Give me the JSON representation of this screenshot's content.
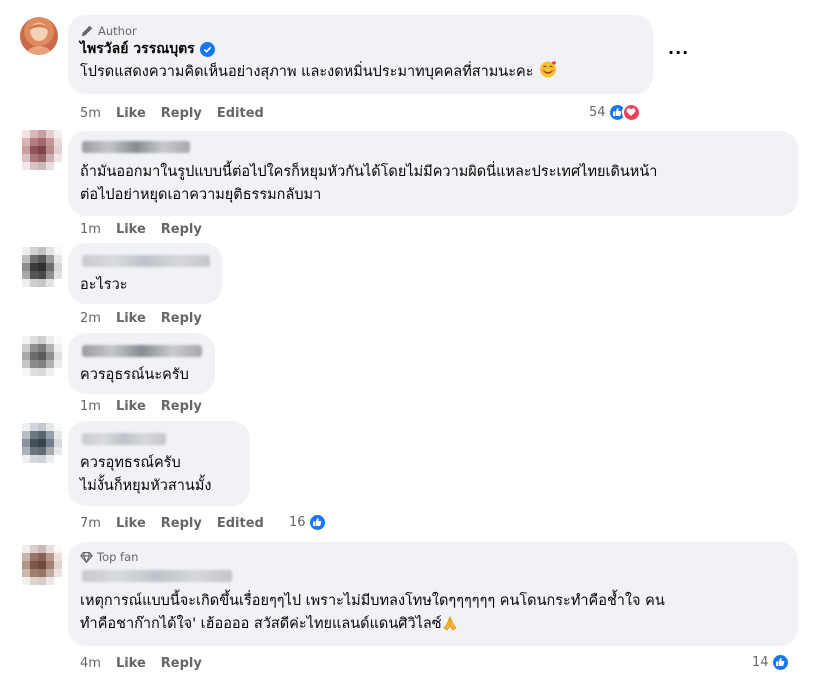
{
  "actions": {
    "like": "Like",
    "reply": "Reply",
    "edited": "Edited"
  },
  "more_label": "···",
  "comments": [
    {
      "badge": "Author",
      "name": "ไพรวัลย์ วรรณบุตร",
      "lines": [
        "โปรดแสดงความคิดเห็นอย่างสุภาพ และงดหมิ่นประมาทบุคคลที่สามนะคะ"
      ],
      "time": "5m",
      "reactions": "54"
    },
    {
      "lines": [
        "ถ้ามันออกมาในรูปแบบนี้ต่อไปใครก็หยุมหัวกันได้โดยไม่มีความผิดนี่แหละประเทศไทยเดินหน้า",
        "ต่อไปอย่าหยุดเอาความยุติธรรมกลับมา"
      ],
      "time": "1m"
    },
    {
      "lines": [
        "อะไรวะ"
      ],
      "time": "2m"
    },
    {
      "lines": [
        "ควรอุธรณ์นะครับ"
      ],
      "time": "1m"
    },
    {
      "lines": [
        "ควรอุทธรณ์ครับ",
        "ไม่งั้นก็หยุมหัวสานมั้ง"
      ],
      "time": "7m",
      "reactions": "16"
    },
    {
      "badge": "Top fan",
      "lines": [
        "เหตุการณ์แบบนี้จะเกิดขึ้นเรื่อยๆๆไป เพราะไม่มีบทลงโทษใดๆๆๆๆๆๆ คนโดนกระทำคือช้ำใจ คน",
        "ทำคือชาก๊ากได้ใจ' เฮ้ออออ สวัสดีค่ะไทยแลนด์แดนศิวิไลซ์"
      ],
      "time": "4m",
      "reactions": "14"
    }
  ]
}
